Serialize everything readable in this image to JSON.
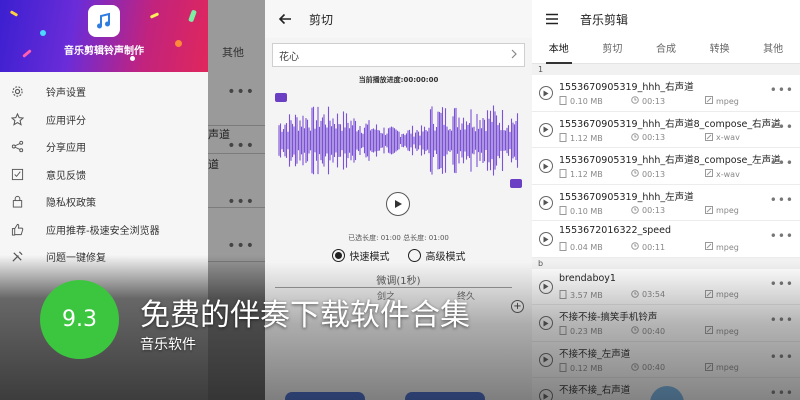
{
  "left": {
    "app_name": "音乐剪辑铃声制作",
    "bg_tab": "其他",
    "bg_fragments": [
      "声道",
      "道"
    ],
    "menu": [
      {
        "icon": "gear-icon",
        "label": "铃声设置"
      },
      {
        "icon": "star-icon",
        "label": "应用评分"
      },
      {
        "icon": "share-icon",
        "label": "分享应用"
      },
      {
        "icon": "feedback-icon",
        "label": "意见反馈"
      },
      {
        "icon": "lock-icon",
        "label": "隐私权政策"
      },
      {
        "icon": "thumbs-up-icon",
        "label": "应用推荐-极速安全浏览器"
      },
      {
        "icon": "wrench-icon",
        "label": "问题一键修复"
      }
    ]
  },
  "middle": {
    "title": "剪切",
    "song": "花心",
    "progress_text": "当前播放进度:00:00:00",
    "selected_length": "已选长度: 01:00 总长度: 01:00",
    "mode_fast": "快速模式",
    "mode_advanced": "高级模式",
    "fine_tune": "微调(1秒)",
    "label_start": "剑之",
    "label_end": "终久",
    "plus": "+"
  },
  "right": {
    "title": "音乐剪辑",
    "tabs": [
      "本地",
      "剪切",
      "合成",
      "转换",
      "其他"
    ],
    "groups": [
      {
        "header": "1",
        "items": [
          {
            "name": "1553670905319_hhh_右声道",
            "size": "0.10 MB",
            "duration": "00:13",
            "format": "mpeg"
          },
          {
            "name": "1553670905319_hhh_右声道8_compose_右声道",
            "size": "1.12 MB",
            "duration": "00:13",
            "format": "x-wav"
          },
          {
            "name": "1553670905319_hhh_右声道8_compose_左声道",
            "size": "1.12 MB",
            "duration": "00:13",
            "format": "x-wav"
          },
          {
            "name": "1553670905319_hhh_左声道",
            "size": "0.10 MB",
            "duration": "00:13",
            "format": "mpeg"
          },
          {
            "name": "1553672016322_speed",
            "size": "0.04 MB",
            "duration": "00:11",
            "format": "mpeg"
          }
        ]
      },
      {
        "header": "b",
        "items": [
          {
            "name": "brendaboy1",
            "size": "3.57 MB",
            "duration": "03:54",
            "format": "mpeg"
          },
          {
            "name": "不接不接-搞笑手机铃声",
            "size": "0.23 MB",
            "duration": "00:40",
            "format": "mpeg"
          },
          {
            "name": "不接不接_左声道",
            "size": "0.12 MB",
            "duration": "00:40",
            "format": "mpeg"
          },
          {
            "name": "不接不接_右声道",
            "size": "",
            "duration": "",
            "format": ""
          }
        ]
      }
    ]
  },
  "overlay": {
    "score": "9.3",
    "headline": "免费的伴奏下载软件合集",
    "subline": "音乐软件"
  },
  "colors": {
    "score_green": "#3cc640",
    "waveform": "#7b52d6",
    "header_gradient": [
      "#3b1fd0",
      "#c2237d",
      "#e0275c"
    ]
  }
}
